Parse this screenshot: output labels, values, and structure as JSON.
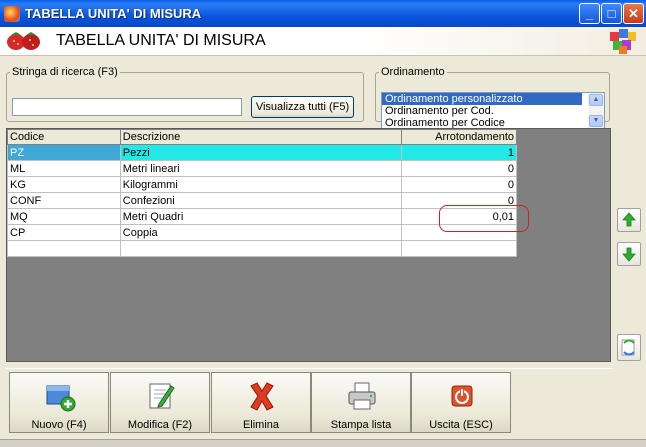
{
  "window": {
    "title": "TABELLA UNITA' DI MISURA",
    "minimize_label": "_",
    "restore_label": "□",
    "close_label": "✕"
  },
  "header": {
    "heading": "TABELLA UNITA' DI MISURA"
  },
  "search": {
    "legend": "Stringa di ricerca (F3)",
    "value": "",
    "show_all_label": "Visualizza tutti (F5)"
  },
  "ordering": {
    "legend": "Ordinamento",
    "options": [
      "Ordinamento personalizzato",
      "Ordinamento per Cod.",
      "Ordinamento per Codice"
    ],
    "selected_index": 0
  },
  "grid": {
    "columns": [
      "Codice",
      "Descrizione",
      "Arrotondamento"
    ],
    "rows": [
      {
        "code": "PZ",
        "description": "Pezzi",
        "rounding": "1"
      },
      {
        "code": "ML",
        "description": "Metri lineari",
        "rounding": "0"
      },
      {
        "code": "KG",
        "description": "Kilogrammi",
        "rounding": "0"
      },
      {
        "code": "CONF",
        "description": "Confezioni",
        "rounding": "0"
      },
      {
        "code": "MQ",
        "description": "Metri Quadri",
        "rounding": "0,01"
      },
      {
        "code": "CP",
        "description": "Coppia",
        "rounding": ""
      },
      {
        "code": "",
        "description": "",
        "rounding": ""
      }
    ],
    "selected_row": 0
  },
  "side_buttons": {
    "up_icon": "arrow-up-icon",
    "down_icon": "arrow-down-icon",
    "refresh_icon": "refresh-icon"
  },
  "toolbar": {
    "new_label": "Nuovo (F4)",
    "edit_label": "Modifica (F2)",
    "delete_label": "Elimina",
    "print_label": "Stampa lista",
    "exit_label": "Uscita (ESC)"
  },
  "colors": {
    "titlebar": "#0a55de",
    "selected_row": "#22e8e8",
    "highlight_ring": "#d02020",
    "list_selection": "#316ac5"
  }
}
